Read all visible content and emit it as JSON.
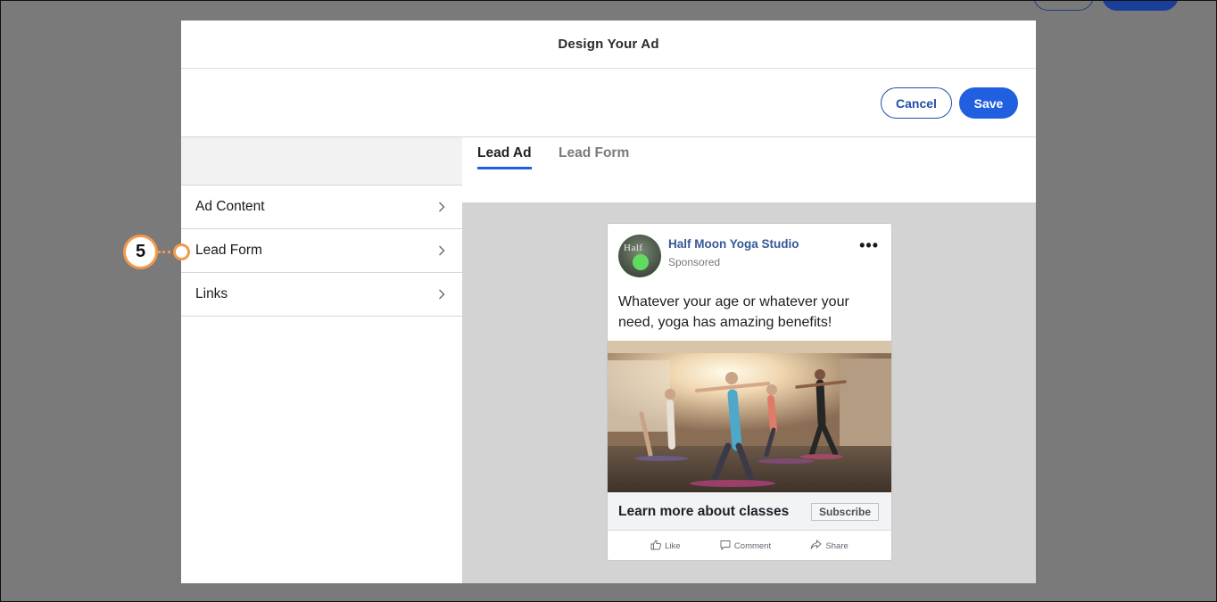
{
  "modal": {
    "title": "Design Your Ad",
    "cancel_label": "Cancel",
    "save_label": "Save"
  },
  "sidebar": {
    "items": [
      {
        "label": "Ad Content"
      },
      {
        "label": "Lead Form"
      },
      {
        "label": "Links"
      }
    ]
  },
  "tabs": [
    {
      "label": "Lead Ad",
      "active": true
    },
    {
      "label": "Lead Form",
      "active": false
    }
  ],
  "ad_preview": {
    "page_name": "Half Moon Yoga Studio",
    "sponsored": "Sponsored",
    "avatar_text": "Half",
    "body_text": "Whatever your age or whatever your need, yoga has amazing benefits!",
    "cta_headline": "Learn more about classes",
    "cta_button": "Subscribe",
    "actions": [
      {
        "label": "Like",
        "icon": "thumbs-up-icon"
      },
      {
        "label": "Comment",
        "icon": "comment-icon"
      },
      {
        "label": "Share",
        "icon": "share-icon"
      }
    ]
  },
  "callout": {
    "number": "5"
  },
  "colors": {
    "primary": "#1f5fe0",
    "callout": "#f39a4a",
    "fb_link": "#365899",
    "overlay": "#7a7a7a"
  }
}
